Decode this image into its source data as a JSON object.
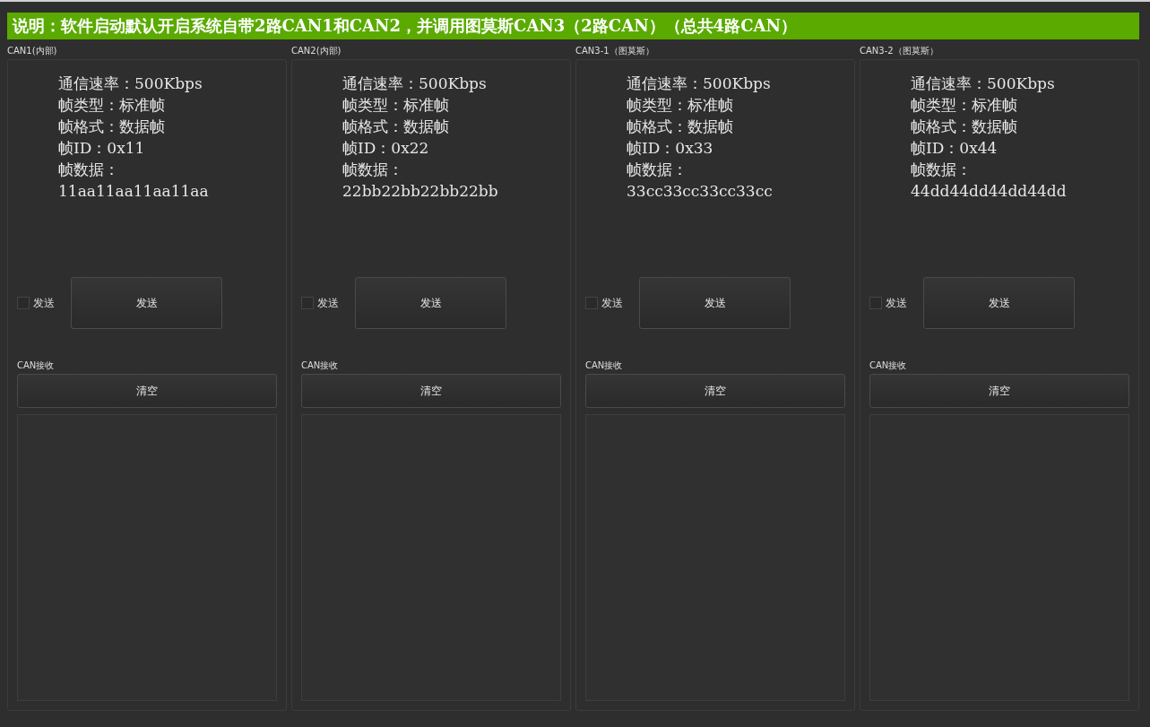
{
  "banner": "说明：软件启动默认开启系统自带2路CAN1和CAN2，并调用图莫斯CAN3（2路CAN）（总共4路CAN）",
  "panels": [
    {
      "title": "CAN1(内部)",
      "info": [
        "通信速率：500Kbps",
        "帧类型：标准帧",
        "帧格式：数据帧",
        "帧ID：0x11",
        "帧数据：",
        "11aa11aa11aa11aa"
      ],
      "send_checkbox": {
        "label": "发送",
        "checked": false
      },
      "send_button": "发送",
      "receive_label": "CAN接收",
      "clear_button": "清空"
    },
    {
      "title": "CAN2(内部)",
      "info": [
        "通信速率：500Kbps",
        "帧类型：标准帧",
        "帧格式：数据帧",
        "帧ID：0x22",
        "帧数据：",
        "22bb22bb22bb22bb"
      ],
      "send_checkbox": {
        "label": "发送",
        "checked": false
      },
      "send_button": "发送",
      "receive_label": "CAN接收",
      "clear_button": "清空"
    },
    {
      "title": "CAN3-1（图莫斯）",
      "info": [
        "通信速率：500Kbps",
        "帧类型：标准帧",
        "帧格式：数据帧",
        "帧ID：0x33",
        "帧数据：",
        "33cc33cc33cc33cc"
      ],
      "send_checkbox": {
        "label": "发送",
        "checked": false
      },
      "send_button": "发送",
      "receive_label": "CAN接收",
      "clear_button": "清空"
    },
    {
      "title": "CAN3-2（图莫斯）",
      "info": [
        "通信速率：500Kbps",
        "帧类型：标准帧",
        "帧格式：数据帧",
        "帧ID：0x44",
        "帧数据：",
        "44dd44dd44dd44dd"
      ],
      "send_checkbox": {
        "label": "发送",
        "checked": false
      },
      "send_button": "发送",
      "receive_label": "CAN接收",
      "clear_button": "清空"
    }
  ]
}
